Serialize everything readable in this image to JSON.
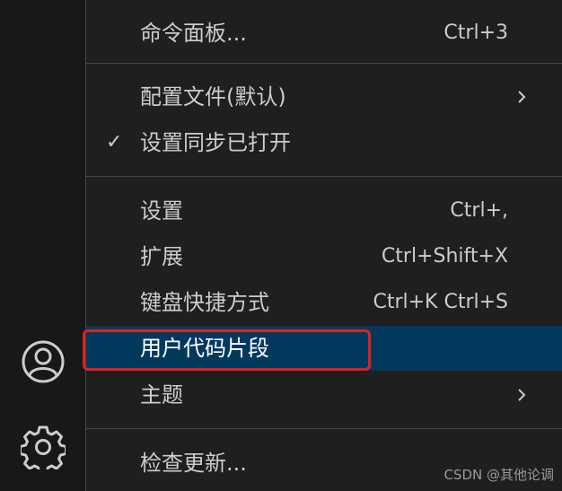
{
  "menu": {
    "items": [
      {
        "label": "命令面板...",
        "shortcut": "Ctrl+3"
      },
      {
        "label": "配置文件(默认)",
        "shortcut": ""
      },
      {
        "label": "设置同步已打开",
        "shortcut": "",
        "check": "✓"
      },
      {
        "label": "设置",
        "shortcut": "Ctrl+,"
      },
      {
        "label": "扩展",
        "shortcut": "Ctrl+Shift+X"
      },
      {
        "label": "键盘快捷方式",
        "shortcut": "Ctrl+K Ctrl+S"
      },
      {
        "label": "用户代码片段",
        "shortcut": ""
      },
      {
        "label": "主题",
        "shortcut": ""
      },
      {
        "label": "检查更新...",
        "shortcut": ""
      }
    ]
  },
  "activity_bar": {
    "icons": [
      "account-icon",
      "gear-icon"
    ]
  },
  "colors": {
    "menu_background": "#1f1f1f",
    "selected_background": "#04395e",
    "annotation_box": "#e02020",
    "text": "#cccccc"
  },
  "watermark": "CSDN @其他论调"
}
